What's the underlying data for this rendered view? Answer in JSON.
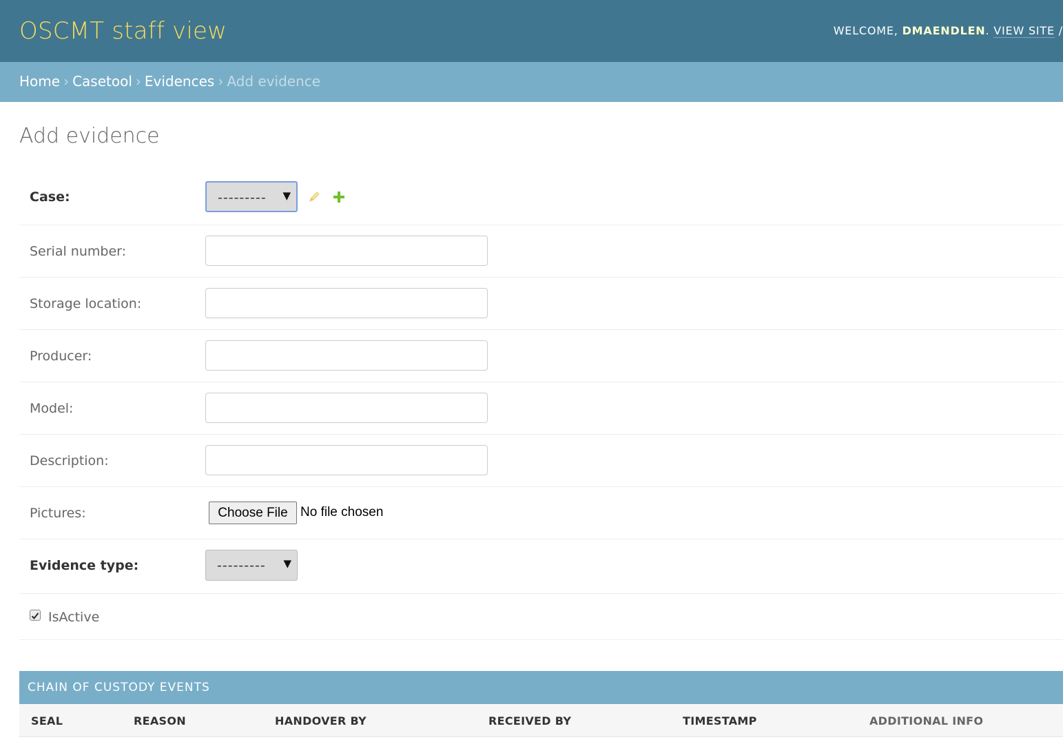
{
  "header": {
    "site_title": "OSCMT staff view",
    "welcome": "WELCOME, ",
    "username": "DMAENDLEN",
    "welcome_end": ". ",
    "view_site": "VIEW SITE",
    "trail": " /"
  },
  "breadcrumbs": {
    "items": [
      "Home",
      "Casetool",
      "Evidences"
    ],
    "separator": "›",
    "current": "Add evidence"
  },
  "page_title": "Add evidence",
  "form": {
    "case": {
      "label": "Case:",
      "value": "---------"
    },
    "serial_number": {
      "label": "Serial number:",
      "value": ""
    },
    "storage_location": {
      "label": "Storage location:",
      "value": ""
    },
    "producer": {
      "label": "Producer:",
      "value": ""
    },
    "model": {
      "label": "Model:",
      "value": ""
    },
    "description": {
      "label": "Description:",
      "value": ""
    },
    "pictures": {
      "label": "Pictures:",
      "button": "Choose File",
      "status": "No file chosen"
    },
    "evidence_type": {
      "label": "Evidence type:",
      "value": "---------"
    },
    "is_active": {
      "label": "IsActive",
      "checked": true
    }
  },
  "inline": {
    "title": "CHAIN OF CUSTODY EVENTS",
    "columns": [
      "SEAL",
      "REASON",
      "HANDOVER BY",
      "RECEIVED BY",
      "TIMESTAMP",
      "ADDITIONAL INFO"
    ]
  },
  "colors": {
    "header_bg": "#417690",
    "brand": "#f5dd5d",
    "breadcrumb_bg": "#79aec8",
    "add_icon": "#70bf2b",
    "change_icon": "#efb80b"
  },
  "icons": {
    "case_change": "pencil-icon",
    "case_add": "plus-icon",
    "select_arrow": "triangle-down-icon",
    "checkbox": "checkmark-icon"
  }
}
